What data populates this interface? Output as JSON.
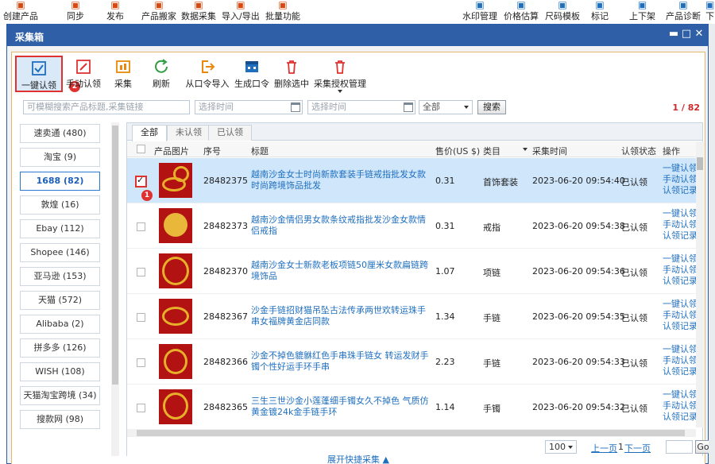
{
  "app_toolbar": [
    {
      "label": "创建产品",
      "icon": "grid-icon"
    },
    {
      "label": "同步",
      "icon": "sync-icon"
    },
    {
      "label": "发布",
      "icon": "publish-icon"
    },
    {
      "label": "产品搬家",
      "icon": "move-icon"
    },
    {
      "label": "数据采集",
      "icon": "collect-icon"
    },
    {
      "label": "导入/导出",
      "icon": "import-export-icon"
    },
    {
      "label": "批量功能",
      "icon": "batch-icon"
    },
    {
      "label": "水印管理",
      "icon": "watermark-icon"
    },
    {
      "label": "价格估算",
      "icon": "price-icon"
    },
    {
      "label": "尺码模板",
      "icon": "size-icon"
    },
    {
      "label": "标记",
      "icon": "mark-icon"
    },
    {
      "label": "上下架",
      "icon": "shelf-icon"
    },
    {
      "label": "产品诊断",
      "icon": "diagnose-icon"
    },
    {
      "label": "下",
      "icon": "more-icon"
    }
  ],
  "window": {
    "title": "采集箱",
    "controls": {
      "min": "▬",
      "max": "□",
      "close": "✕"
    }
  },
  "toolbar": {
    "one_click_claim": "一键认领",
    "manual_claim": "手动认领",
    "collect": "采集",
    "refresh": "刷新",
    "import_from_code": "从口令导入",
    "generate_code": "生成口令",
    "delete_selected": "删除选中",
    "collect_auth": "采集授权管理",
    "badge_2": "2"
  },
  "search": {
    "keyword_placeholder": "可模糊搜索产品标题,采集链接",
    "start_time_placeholder": "选择时间",
    "end_time_placeholder": "选择时间",
    "status_value": "全部",
    "search_button": "搜索",
    "count": "1 / 82"
  },
  "platforms": [
    {
      "label": "速卖通 (480)"
    },
    {
      "label": "淘宝 (9)"
    },
    {
      "label": "1688 (82)",
      "selected": true
    },
    {
      "label": "敦煌 (16)"
    },
    {
      "label": "Ebay (112)"
    },
    {
      "label": "Shopee (146)"
    },
    {
      "label": "亚马逊 (153)"
    },
    {
      "label": "天猫 (572)"
    },
    {
      "label": "Alibaba (2)"
    },
    {
      "label": "拼多多 (126)"
    },
    {
      "label": "WISH (108)"
    },
    {
      "label": "天猫淘宝跨境 (34)"
    },
    {
      "label": "搜款网 (98)"
    }
  ],
  "tabs": [
    "全部",
    "未认领",
    "已认领"
  ],
  "columns": {
    "image": "产品图片",
    "seq": "序号",
    "title": "标题",
    "price": "售价(US $)",
    "category": "类目",
    "time": "采集时间",
    "status": "认领状态",
    "ops": "操作"
  },
  "rows": [
    {
      "seq": "28482375",
      "title": "越南沙金女士时尚新款套装手链戒指批发女款时尚跨境饰品批发",
      "price": "0.31",
      "category": "首饰套装",
      "time": "2023-06-20 09:54:40",
      "status": "已认领",
      "checked": true
    },
    {
      "seq": "28482373",
      "title": "越南沙金情侣男女款条纹戒指批发沙金女款情侣戒指",
      "price": "0.31",
      "category": "戒指",
      "time": "2023-06-20 09:54:38",
      "status": "已认领",
      "checked": false
    },
    {
      "seq": "28482370",
      "title": "越南沙金女士新款老板项链50厘米女款扁链跨境饰品",
      "price": "1.07",
      "category": "项链",
      "time": "2023-06-20 09:54:36",
      "status": "已认领",
      "checked": false
    },
    {
      "seq": "28482367",
      "title": "沙金手链招财猫吊坠古法传承两世欢转运珠手串女福牌黄金店同款",
      "price": "1.34",
      "category": "手链",
      "time": "2023-06-20 09:54:35",
      "status": "已认领",
      "checked": false
    },
    {
      "seq": "28482366",
      "title": "沙金不掉色貔貅红色手串珠手链女 转运发财手镯个性好运手环手串",
      "price": "2.23",
      "category": "手链",
      "time": "2023-06-20 09:54:33",
      "status": "已认领",
      "checked": false
    },
    {
      "seq": "28482365",
      "title": "三生三世沙金小莲蓬细手镯女久不掉色 气质仿黄金镀24k金手链手环",
      "price": "1.14",
      "category": "手镯",
      "time": "2023-06-20 09:54:32",
      "status": "已认领",
      "checked": false
    }
  ],
  "ops": {
    "claim_one": "一键认领",
    "claim_manual": "手动认领",
    "claim_record": "认领记录"
  },
  "row_badge": "1",
  "pager": {
    "page_size": "100",
    "prev": "上一页",
    "next": "下一页",
    "sep": "1",
    "go": "Go"
  },
  "expand": "展开快捷采集 ▲"
}
